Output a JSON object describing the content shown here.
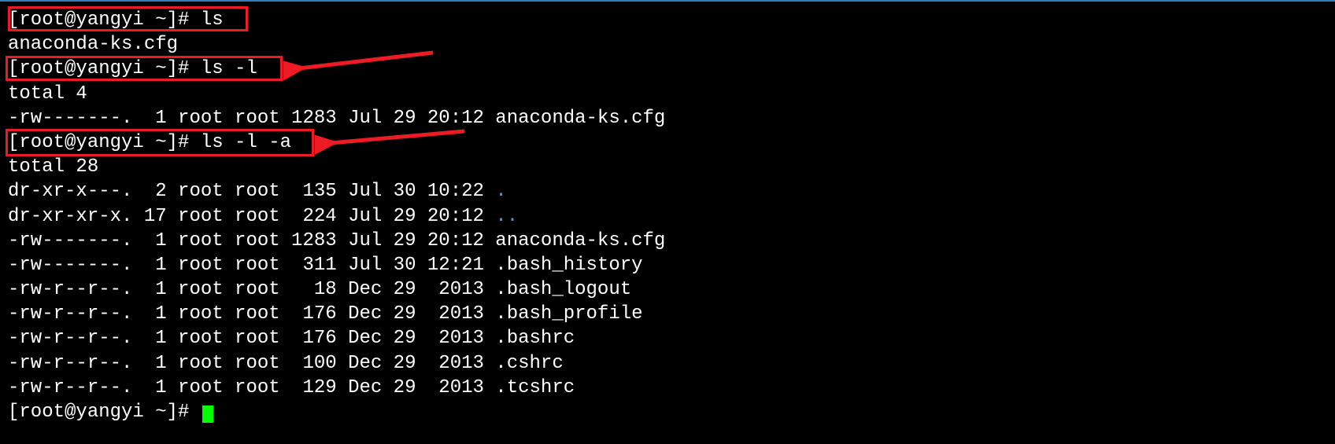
{
  "prompt": "[root@yangyi ~]# ",
  "commands": {
    "cmd1": "ls",
    "cmd2": "ls -l",
    "cmd3": "ls -l -a"
  },
  "output": {
    "ls_result": "anaconda-ks.cfg",
    "ls_l_total": "total 4",
    "ls_l_line1": "-rw-------.  1 root root 1283 Jul 29 20:12 anaconda-ks.cfg",
    "ls_la_total": "total 28",
    "ls_la_rows": [
      {
        "perms": "dr-xr-x---.",
        "links": " 2",
        "user": "root",
        "group": "root",
        "size": " 135",
        "date": "Jul 30 10:22",
        "name": ".",
        "color": "dir"
      },
      {
        "perms": "dr-xr-xr-x.",
        "links": "17",
        "user": "root",
        "group": "root",
        "size": " 224",
        "date": "Jul 29 20:12",
        "name": "..",
        "color": "dir"
      },
      {
        "perms": "-rw-------.",
        "links": " 1",
        "user": "root",
        "group": "root",
        "size": "1283",
        "date": "Jul 29 20:12",
        "name": "anaconda-ks.cfg",
        "color": "normal"
      },
      {
        "perms": "-rw-------.",
        "links": " 1",
        "user": "root",
        "group": "root",
        "size": " 311",
        "date": "Jul 30 12:21",
        "name": ".bash_history",
        "color": "normal"
      },
      {
        "perms": "-rw-r--r--.",
        "links": " 1",
        "user": "root",
        "group": "root",
        "size": "  18",
        "date": "Dec 29  2013",
        "name": ".bash_logout",
        "color": "normal"
      },
      {
        "perms": "-rw-r--r--.",
        "links": " 1",
        "user": "root",
        "group": "root",
        "size": " 176",
        "date": "Dec 29  2013",
        "name": ".bash_profile",
        "color": "normal"
      },
      {
        "perms": "-rw-r--r--.",
        "links": " 1",
        "user": "root",
        "group": "root",
        "size": " 176",
        "date": "Dec 29  2013",
        "name": ".bashrc",
        "color": "normal"
      },
      {
        "perms": "-rw-r--r--.",
        "links": " 1",
        "user": "root",
        "group": "root",
        "size": " 100",
        "date": "Dec 29  2013",
        "name": ".cshrc",
        "color": "normal"
      },
      {
        "perms": "-rw-r--r--.",
        "links": " 1",
        "user": "root",
        "group": "root",
        "size": " 129",
        "date": "Dec 29  2013",
        "name": ".tcshrc",
        "color": "normal"
      }
    ]
  },
  "last_prompt_partial": "[root@yangyi ~]# "
}
